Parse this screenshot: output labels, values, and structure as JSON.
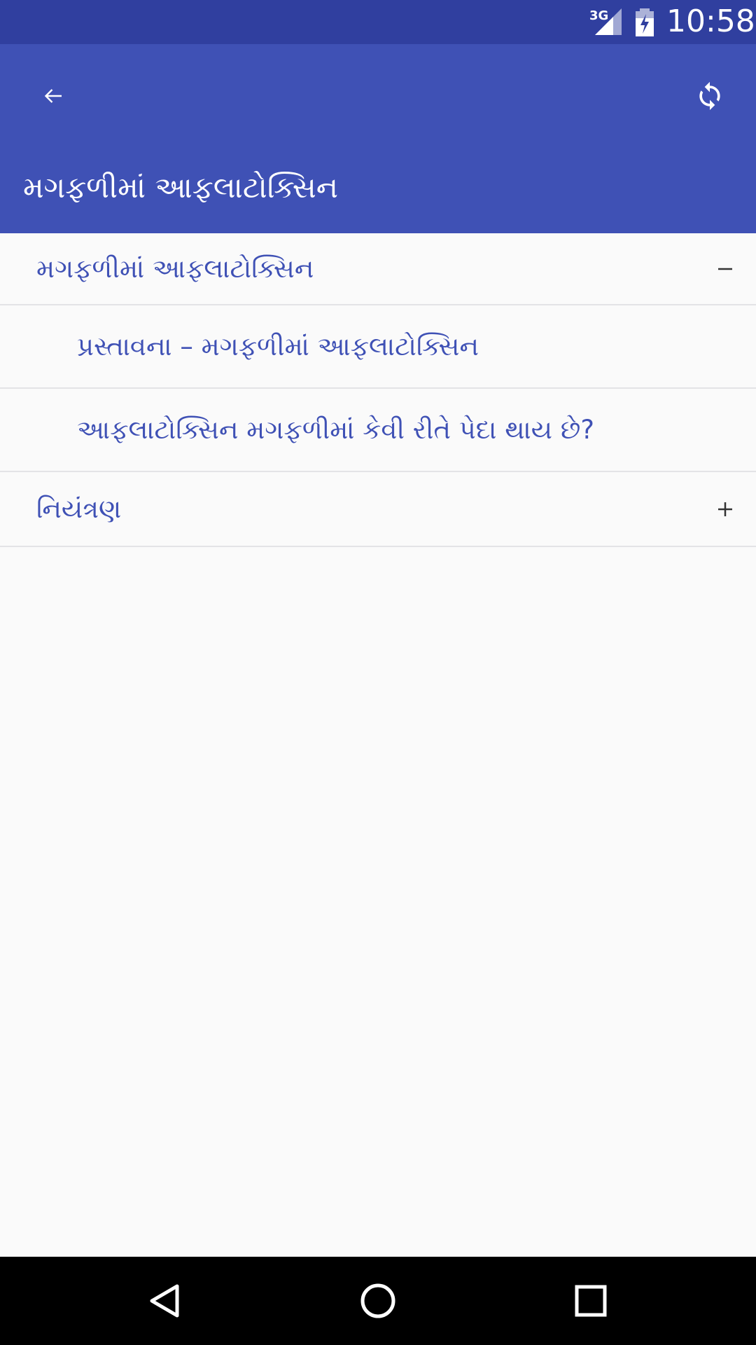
{
  "status_bar": {
    "network": "3G",
    "time": "10:58",
    "signal_icon": "signal-icon",
    "battery_icon": "battery-charging-icon"
  },
  "app_bar": {
    "title": "મગફળીમાં આફલાટોક્સિન",
    "back_icon": "arrow-back-icon",
    "refresh_icon": "refresh-icon",
    "color": "#3f51b5",
    "status_color": "#303f9f"
  },
  "list": {
    "accent_color": "#3f51b5",
    "items": [
      {
        "label": "મગફળીમાં આફલાટોક્સિન",
        "type": "group",
        "expanded": true,
        "toggle_icon": "minus-icon"
      },
      {
        "label": "પ્રસ્તાવના – મગફળીમાં આફલાટોક્સિન",
        "type": "child"
      },
      {
        "label": "આફલાટોક્સિન મગફળીમાં કેવી રીતે પેદા થાય છે?",
        "type": "child"
      },
      {
        "label": "નિયંત્રણ",
        "type": "group",
        "expanded": false,
        "toggle_icon": "plus-icon"
      }
    ]
  },
  "nav_bar": {
    "back_icon": "nav-back-icon",
    "home_icon": "nav-home-icon",
    "recents_icon": "nav-recents-icon"
  }
}
